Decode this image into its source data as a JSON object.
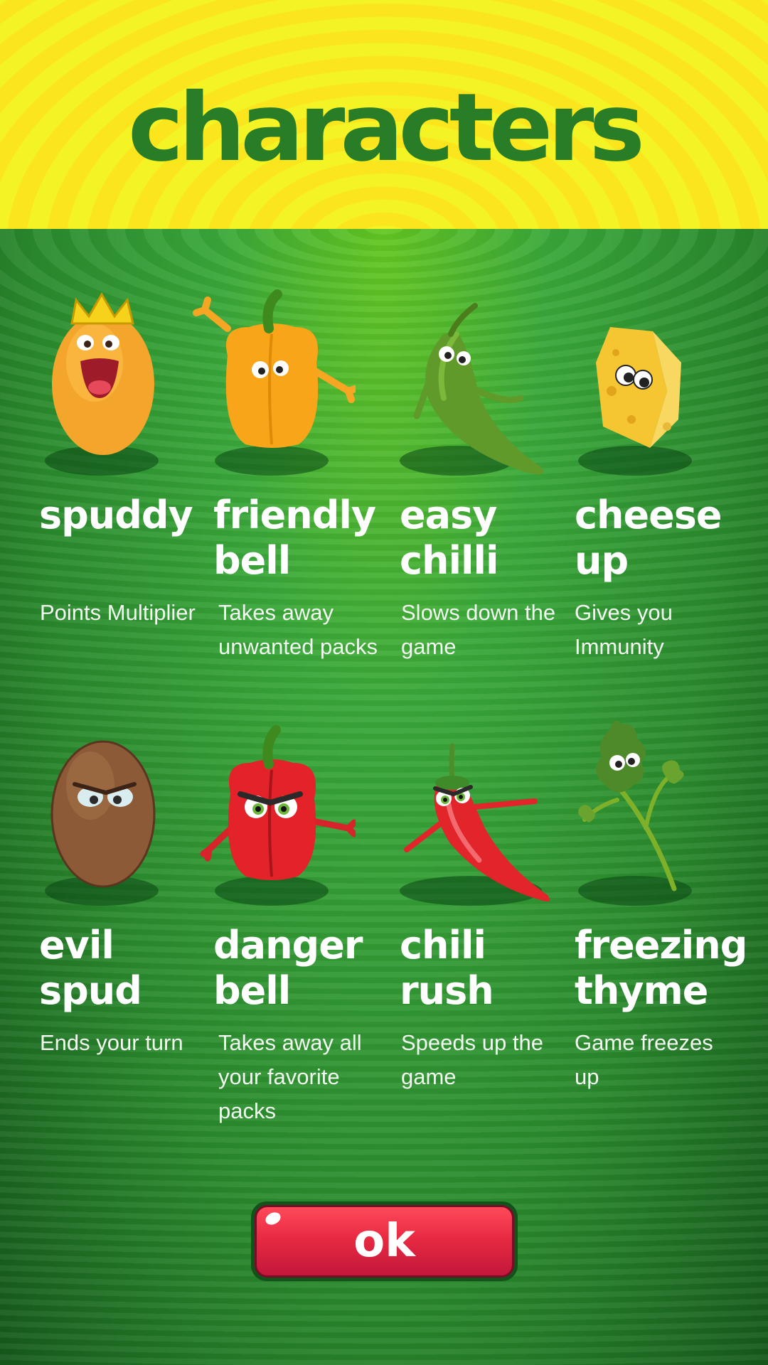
{
  "header": {
    "title": "characters"
  },
  "characters": [
    {
      "id": "spuddy",
      "name": "spuddy",
      "description": "Points Multiplier",
      "icon": "crowned-potato-icon"
    },
    {
      "id": "friendly-bell",
      "name": "friendly\nbell",
      "description": "Takes away\nunwanted packs",
      "icon": "yellow-bell-pepper-icon"
    },
    {
      "id": "easy-chilli",
      "name": "easy\nchilli",
      "description": "Slows down the\ngame",
      "icon": "green-chilli-icon"
    },
    {
      "id": "cheese-up",
      "name": "cheese\nup",
      "description": "Gives you\nImmunity",
      "icon": "cheese-wedge-icon"
    },
    {
      "id": "evil-spud",
      "name": "evil\nspud",
      "description": "Ends your turn",
      "icon": "angry-potato-icon"
    },
    {
      "id": "danger-bell",
      "name": "danger\nbell",
      "description": "Takes away all\nyour favorite\npacks",
      "icon": "angry-red-pepper-icon"
    },
    {
      "id": "chili-rush",
      "name": "chili\nrush",
      "description": "Speeds up the\ngame",
      "icon": "red-chilli-icon"
    },
    {
      "id": "freezing-thyme",
      "name": "freezing\nthyme",
      "description": "Game freezes\nup",
      "icon": "thyme-sprig-icon"
    }
  ],
  "ok_button": {
    "label": "ok"
  },
  "colors": {
    "title": "#2a7d27",
    "header_yellow": "#f4f425",
    "background_green": "#2a8a2d",
    "button_red": "#e82a42"
  }
}
